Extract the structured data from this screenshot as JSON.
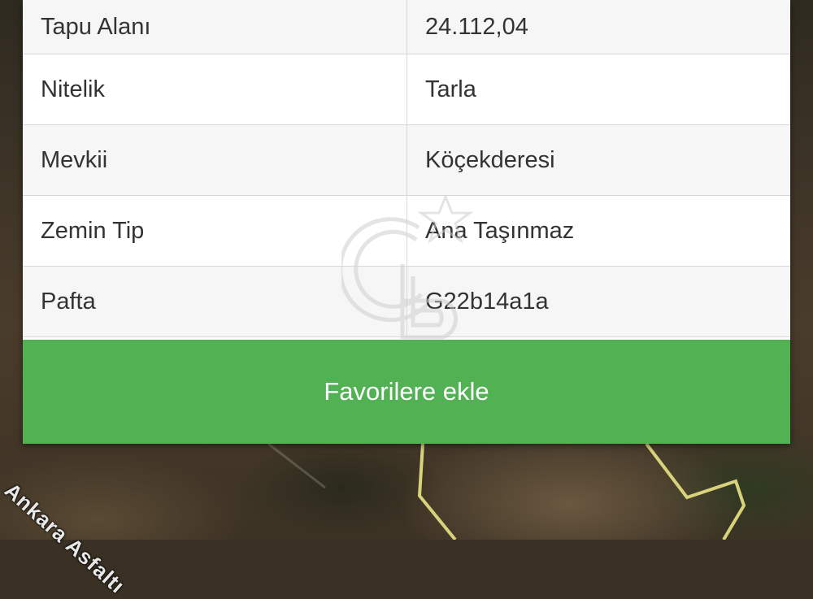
{
  "map": {
    "road_label": "Ankara Asfaltı",
    "parcel_outline_color": "#d8d27a"
  },
  "details": {
    "rows": [
      {
        "label": "Tapu Alanı",
        "value": "24.112,04"
      },
      {
        "label": "Nitelik",
        "value": "Tarla"
      },
      {
        "label": "Mevkii",
        "value": "Köçekderesi"
      },
      {
        "label": "Zemin Tip",
        "value": "Ana Taşınmaz"
      },
      {
        "label": "Pafta",
        "value": "G22b14a1a"
      }
    ]
  },
  "actions": {
    "favorite_label": "Favorilere ekle",
    "favorite_color": "#52b153"
  },
  "watermark": {
    "icon": "cb-logo-watermark"
  }
}
